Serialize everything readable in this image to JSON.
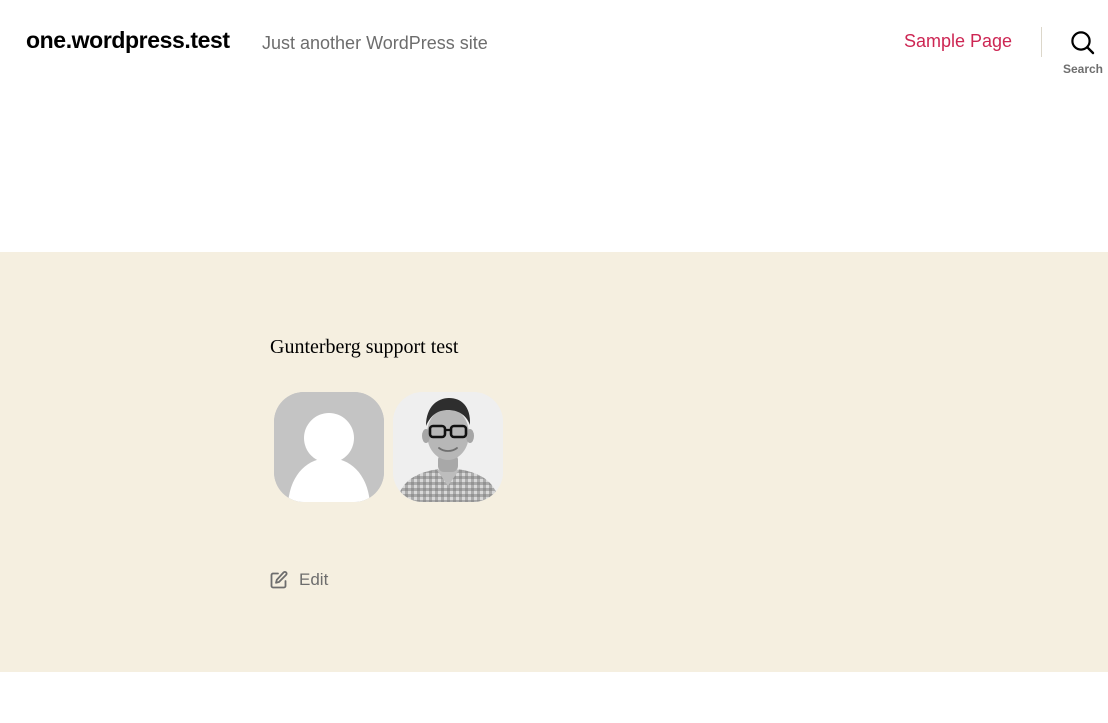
{
  "header": {
    "site_title": "one.wordpress.test",
    "site_description": "Just another WordPress site",
    "nav_items": [
      "Sample Page"
    ],
    "search_label": "Search",
    "accent_color": "#cd2653"
  },
  "content": {
    "background_color": "#f5efe0",
    "text": "Gunterberg support test",
    "avatars": [
      {
        "type": "default-silhouette"
      },
      {
        "type": "photo-man-with-glasses"
      }
    ],
    "edit_label": "Edit",
    "edit_icon": "edit-icon"
  }
}
